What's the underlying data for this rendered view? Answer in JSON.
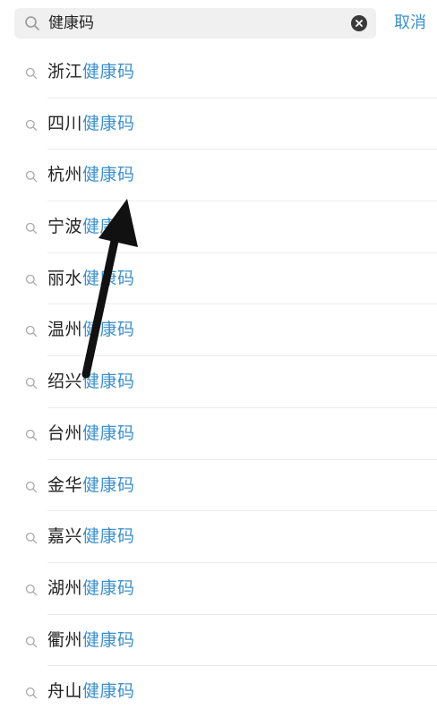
{
  "search": {
    "query": "健康码",
    "cancel_label": "取消"
  },
  "suggestions": [
    {
      "prefix": "浙江",
      "keyword": "健康码"
    },
    {
      "prefix": "四川",
      "keyword": "健康码"
    },
    {
      "prefix": "杭州",
      "keyword": "健康码"
    },
    {
      "prefix": "宁波",
      "keyword": "健康码"
    },
    {
      "prefix": "丽水",
      "keyword": "健康码"
    },
    {
      "prefix": "温州",
      "keyword": "健康码"
    },
    {
      "prefix": "绍兴",
      "keyword": "健康码"
    },
    {
      "prefix": "台州",
      "keyword": "健康码"
    },
    {
      "prefix": "金华",
      "keyword": "健康码"
    },
    {
      "prefix": "嘉兴",
      "keyword": "健康码"
    },
    {
      "prefix": "湖州",
      "keyword": "健康码"
    },
    {
      "prefix": "衢州",
      "keyword": "健康码"
    },
    {
      "prefix": "舟山",
      "keyword": "健康码"
    }
  ],
  "colors": {
    "highlight": "#3d8fcb",
    "text": "#222222",
    "search_bg": "#f0f0f0",
    "annotation_arrow": "#111111"
  },
  "icons": {
    "search": "search-icon",
    "clear": "clear-icon",
    "annotation": "arrow-annotation"
  }
}
